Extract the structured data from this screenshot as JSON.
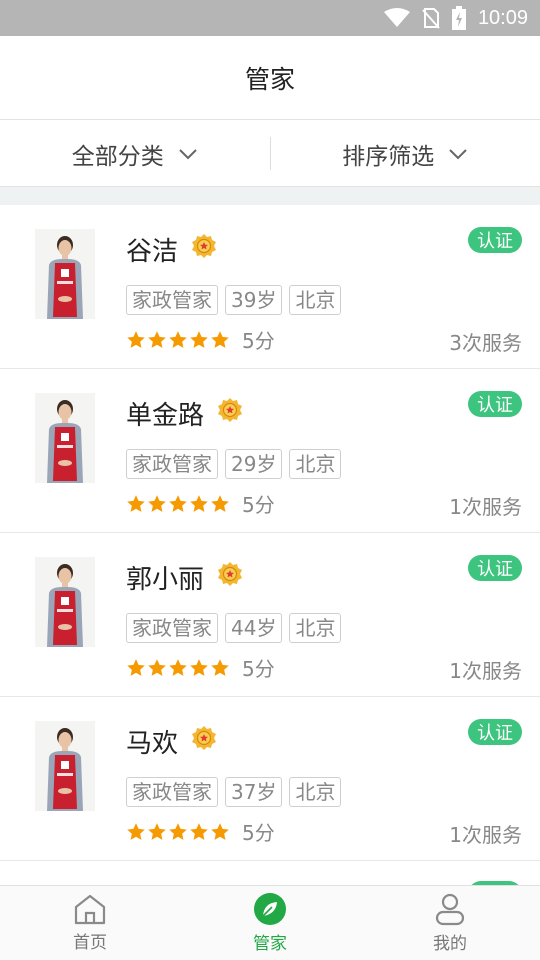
{
  "statusbar": {
    "time": "10:09"
  },
  "header": {
    "title": "管家"
  },
  "filters": {
    "category_label": "全部分类",
    "sort_label": "排序筛选"
  },
  "verified_label": "认证",
  "accent_color": "#3dc47e",
  "star_color": "#f59a00",
  "housekeepers": [
    {
      "name": "谷洁",
      "role": "家政管家",
      "age": "39岁",
      "city": "北京",
      "rating_stars": 5,
      "score": "5分",
      "services": "3次服务"
    },
    {
      "name": "单金路",
      "role": "家政管家",
      "age": "29岁",
      "city": "北京",
      "rating_stars": 5,
      "score": "5分",
      "services": "1次服务"
    },
    {
      "name": "郭小丽",
      "role": "家政管家",
      "age": "44岁",
      "city": "北京",
      "rating_stars": 5,
      "score": "5分",
      "services": "1次服务"
    },
    {
      "name": "马欢",
      "role": "家政管家",
      "age": "37岁",
      "city": "北京",
      "rating_stars": 5,
      "score": "5分",
      "services": "1次服务"
    }
  ],
  "tabbar": {
    "home_label": "首页",
    "butler_label": "管家",
    "mine_label": "我的"
  },
  "icons": {
    "wifi": "wifi-icon",
    "no_sim": "no-sim-icon",
    "battery": "battery-charging-icon",
    "chevron": "chevron-down-icon",
    "medal": "medal-icon",
    "star": "star-icon",
    "home": "home-icon",
    "leaf": "leaf-icon",
    "user": "user-icon"
  }
}
